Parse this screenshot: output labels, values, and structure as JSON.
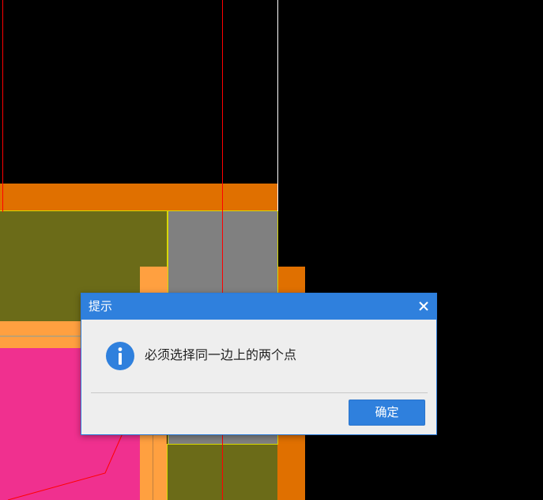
{
  "dialog": {
    "title": "提示",
    "close_icon": "close-icon",
    "info_icon": "info-icon",
    "message": "必须选择同一边上的两个点",
    "ok_label": "确定"
  },
  "colors": {
    "background": "#000000",
    "orange_dark": "#e07000",
    "orange_light": "#ffa040",
    "olive": "#6b6b18",
    "gray": "#808080",
    "magenta": "#f0308f",
    "red_line": "#ff0000",
    "white_line": "#ffffff",
    "yellow_outline": "#d8d800",
    "dialog_blue": "#2f80dd",
    "dialog_body": "#eeeeee"
  }
}
